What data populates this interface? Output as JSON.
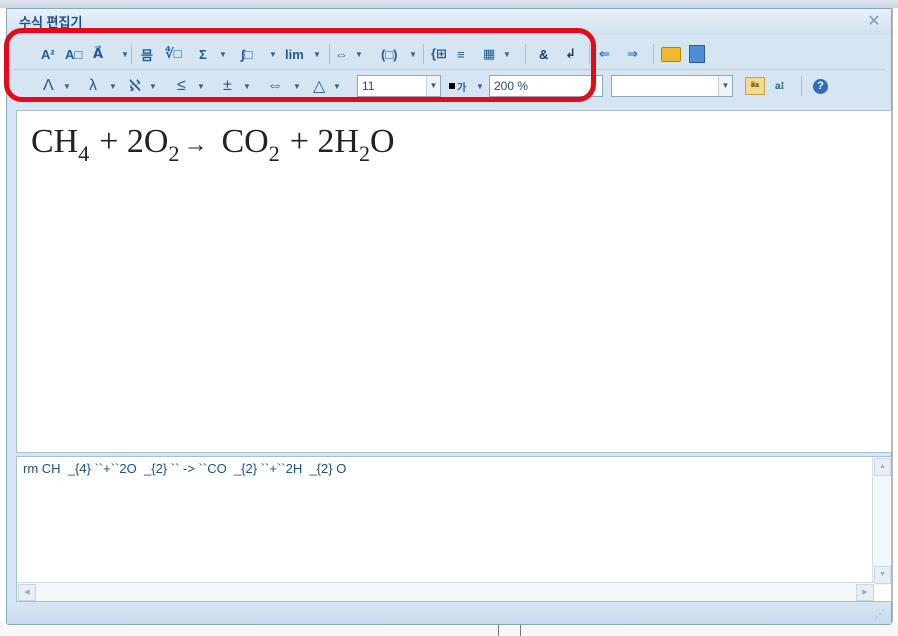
{
  "dialog": {
    "title": "수식 편집기",
    "close_icon": "close-icon",
    "toolbar1": [
      {
        "name": "superscript-tool-icon",
        "glyph": "A²"
      },
      {
        "name": "font-size-tool-icon",
        "glyph": "A□"
      },
      {
        "name": "decoration-tool-icon",
        "glyph": "A⃗"
      },
      {
        "name": "fraction-tool-icon",
        "glyph": "믐"
      },
      {
        "name": "root-tool-icon",
        "glyph": "∜□"
      },
      {
        "name": "sum-tool-icon",
        "glyph": "Σ"
      },
      {
        "name": "integral-tool-icon",
        "glyph": "∫□"
      },
      {
        "name": "limit-tool-icon",
        "glyph": "lim"
      },
      {
        "name": "arrow-tool-icon",
        "glyph": "⇔"
      },
      {
        "name": "bracket-tool-icon",
        "glyph": "(□)"
      },
      {
        "name": "case-tool-icon",
        "glyph": "{⊞"
      },
      {
        "name": "aligned-tool-icon",
        "glyph": "≡"
      },
      {
        "name": "matrix-tool-icon",
        "glyph": "▦"
      },
      {
        "name": "symbol-ampersand-icon",
        "glyph": "&"
      },
      {
        "name": "newline-icon",
        "glyph": "↲"
      },
      {
        "name": "prev-icon",
        "glyph": "⇐"
      },
      {
        "name": "next-icon",
        "glyph": "⇒"
      },
      {
        "name": "open-folder-icon",
        "glyph": ""
      },
      {
        "name": "exit-icon",
        "glyph": ""
      }
    ],
    "toolbar2": [
      {
        "name": "greek-upper-icon",
        "glyph": "Λ"
      },
      {
        "name": "greek-lower-icon",
        "glyph": "λ"
      },
      {
        "name": "hebrew-icon",
        "glyph": "ℵ"
      },
      {
        "name": "relation-icon",
        "glyph": "≤"
      },
      {
        "name": "operator-icon",
        "glyph": "±"
      },
      {
        "name": "arrows-icon",
        "glyph": "⇔"
      },
      {
        "name": "misc-symbol-icon",
        "glyph": "△"
      }
    ],
    "font_size_value": "11",
    "color_label": "가",
    "zoom_value": "200 %",
    "font_select_value": "",
    "formula": {
      "parts": [
        "CH",
        "4",
        "+ 2O",
        "2",
        "→",
        "CO",
        "2",
        "+ 2H",
        "2",
        "O"
      ]
    },
    "script_text": "rm CH  _{4} ``+``2O  _{2} `` -> ``CO  _{2} ``+``2H  _{2} O",
    "help_icon": "?",
    "toggle_icon": "ⅱa"
  },
  "colors": {
    "highlight": "#e30b17",
    "title": "#1d4f84",
    "dialog_bg": "#d5e5f1"
  }
}
